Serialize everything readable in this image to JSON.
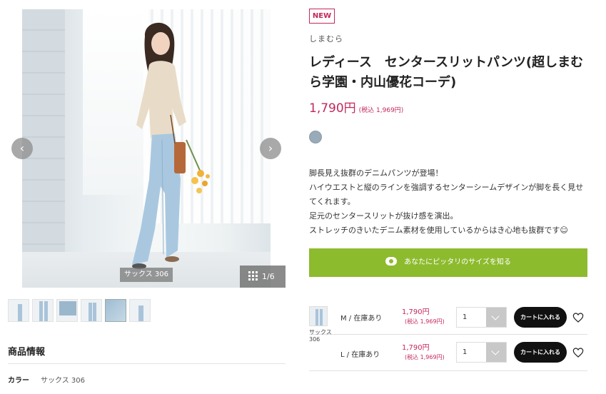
{
  "gallery": {
    "color_caption": "サックス 306",
    "counter": "1/6",
    "prev_label": "‹",
    "next_label": "›",
    "thumb_count": 6
  },
  "product": {
    "badge": "NEW",
    "brand": "しまむら",
    "title": "レディース　センタースリットパンツ(超しまむら学園・内山優花コーデ)",
    "price": "1,790円",
    "price_tax": "(税込 1,969円)",
    "swatch_color": "#99aab8",
    "description": [
      "脚長見え抜群のデニムパンツが登場！",
      "ハイウエストと縦のラインを強調するセンターシームデザインが脚を長く見せてくれます。",
      "足元のセンタースリットが抜け感を演出。",
      "ストレッチのきいたデニム素材を使用しているからはき心地も抜群です☺"
    ],
    "size_button_label": "あなたにピッタリのサイズを知る"
  },
  "sku": {
    "color_label": "サックス 306",
    "rows": [
      {
        "size": "M / 在庫あり",
        "price": "1,790円",
        "price_tax": "(税込 1,969円)",
        "qty": "1",
        "cart_label": "カートに入れる"
      },
      {
        "size": "L / 在庫あり",
        "price": "1,790円",
        "price_tax": "(税込 1,969円)",
        "qty": "1",
        "cart_label": "カートに入れる"
      }
    ]
  },
  "info": {
    "section_title": "商品情報",
    "color_key": "カラー",
    "color_value": "サックス 306"
  },
  "colors": {
    "accent_pink": "#c3285b",
    "size_button_green": "#8dbb2e",
    "cart_black": "#111111"
  }
}
